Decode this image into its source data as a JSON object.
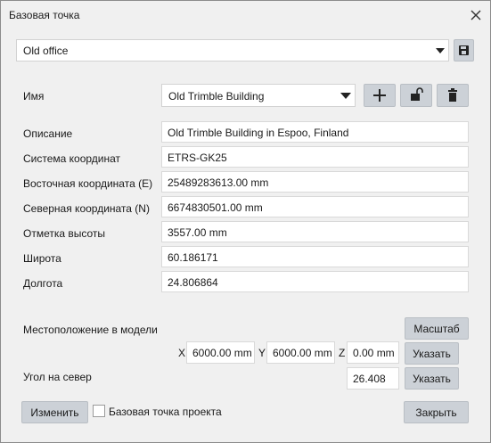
{
  "window": {
    "title": "Базовая точка"
  },
  "top": {
    "preset_value": "Old office"
  },
  "name_row": {
    "label": "Имя",
    "value": "Old Trimble Building"
  },
  "fields": [
    {
      "label": "Описание",
      "value": "Old Trimble Building in Espoo, Finland"
    },
    {
      "label": "Система координат",
      "value": "ETRS-GK25"
    },
    {
      "label": "Восточная координата  (E)",
      "value": "25489283613.00 mm"
    },
    {
      "label": "Северная координата  (N)",
      "value": "6674830501.00 mm"
    },
    {
      "label": "Отметка высоты",
      "value": "3557.00 mm"
    },
    {
      "label": "Широта",
      "value": "60.186171"
    },
    {
      "label": "Долгота",
      "value": "24.806864"
    }
  ],
  "model": {
    "location_label": "Местоположение в модели",
    "scale_button": "Масштаб",
    "x_label": "X",
    "x_value": "6000.00 mm",
    "y_label": "Y",
    "y_value": "6000.00 mm",
    "z_label": "Z",
    "z_value": "0.00 mm",
    "specify_button": "Указать",
    "north_label": "Угол на север",
    "north_value": "26.408",
    "north_specify_button": "Указать"
  },
  "footer": {
    "modify_button": "Изменить",
    "project_basepoint_label": "Базовая точка проекта",
    "close_button": "Закрыть"
  },
  "icons": {
    "save": "save-icon",
    "add": "plus-icon",
    "lock": "lock-open-icon",
    "delete": "trash-icon",
    "close": "close-icon"
  }
}
